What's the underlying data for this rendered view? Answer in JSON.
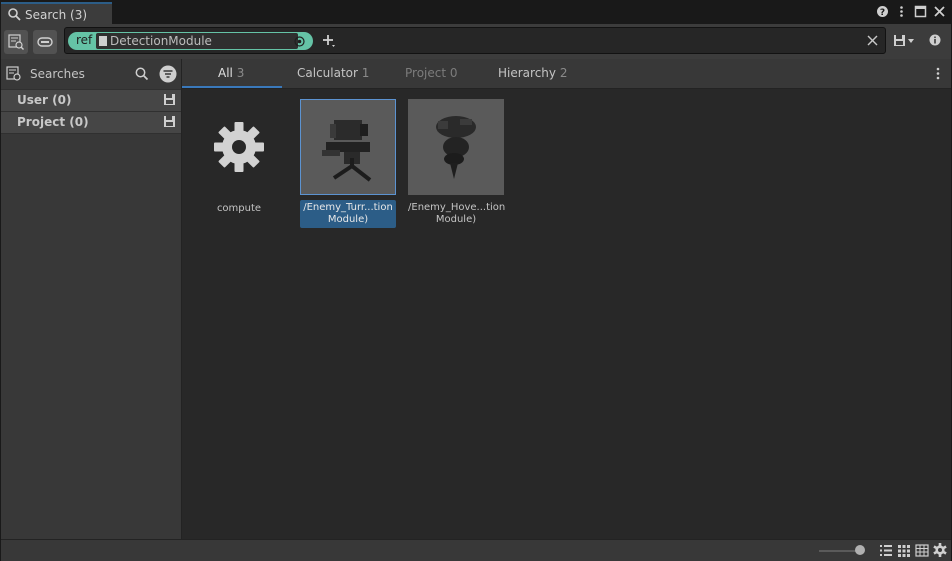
{
  "window": {
    "title": "Search (3)"
  },
  "search": {
    "chip_label": "ref",
    "chip_value": "DetectionModule"
  },
  "sidebar": {
    "header": "Searches",
    "sections": [
      {
        "label": "User (0)"
      },
      {
        "label": "Project (0)"
      }
    ]
  },
  "tabs": [
    {
      "label": "All",
      "count": "3"
    },
    {
      "label": "Calculator",
      "count": "1"
    },
    {
      "label": "Project",
      "count": "0"
    },
    {
      "label": "Hierarchy",
      "count": "2"
    }
  ],
  "results": [
    {
      "caption": "compute",
      "icon": "gear-icon"
    },
    {
      "caption_line1": "/Enemy_Turr...tion",
      "caption_line2": "Module)",
      "selected": true
    },
    {
      "caption_line1": "/Enemy_Hove...tion",
      "caption_line2": "Module)",
      "selected": false
    }
  ],
  "colors": {
    "accent": "#3a79bb",
    "chip": "#65c3a6",
    "selection": "#2c5d87"
  }
}
